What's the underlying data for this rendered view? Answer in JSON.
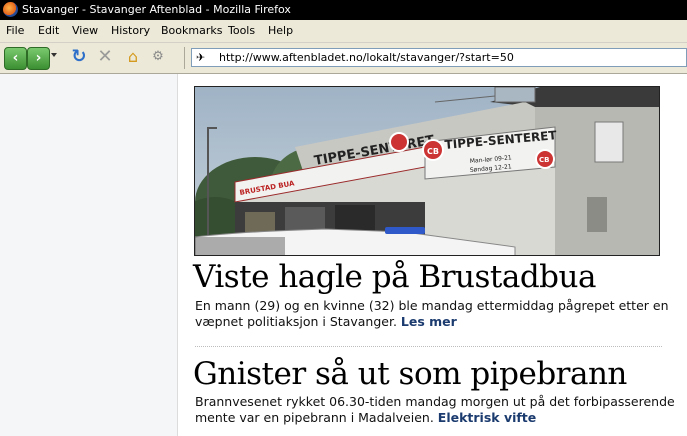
{
  "window": {
    "title": "Stavanger - Stavanger Aftenblad - Mozilla Firefox"
  },
  "menu": {
    "file": "File",
    "edit": "Edit",
    "view": "View",
    "history": "History",
    "bookmarks": "Bookmarks",
    "tools": "Tools",
    "help": "Help"
  },
  "address": {
    "url": "http://www.aftenbladet.no/lokalt/stavanger/?start=50"
  },
  "articles": [
    {
      "headline": "Viste hagle på Brustadbua",
      "body": "En mann (29) og en kvinne (32) ble mandag ettermiddag pågrepet etter en væpnet politiaksjon i Stavanger.",
      "link": "Les mer"
    },
    {
      "headline": "Gnister så ut som pipebrann",
      "body": "Brannvesenet rykket 06.30-tiden mandag morgen ut på det forbipasserende mente var en pipebrann i Madalveien.",
      "link": "Elektrisk vifte"
    }
  ],
  "photo": {
    "sign_main": "TIPPE-SENTERET",
    "sign_left": "BRUSTAD BUA",
    "hours_weekday": "Man-lør 09-21",
    "hours_sunday": "Søndag 12-21",
    "logo": "CB"
  }
}
